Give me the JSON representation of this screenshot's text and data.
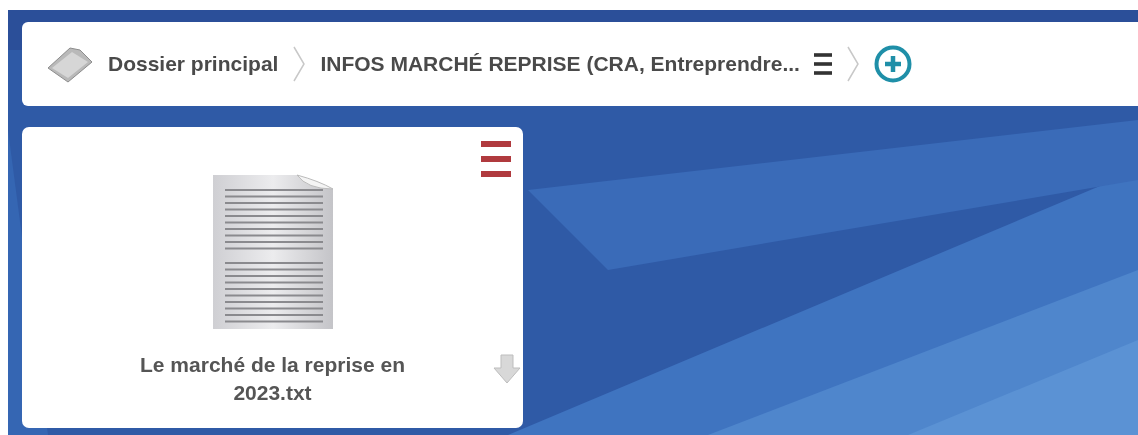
{
  "breadcrumb": {
    "items": [
      {
        "label": "Dossier principal",
        "kind": "root"
      },
      {
        "label": "INFOS MARCHÉ REPRISE (CRA, Entreprendre...",
        "kind": "folder"
      }
    ]
  },
  "files": [
    {
      "name": "Le marché de la reprise en 2023.txt",
      "kind": "text"
    }
  ]
}
